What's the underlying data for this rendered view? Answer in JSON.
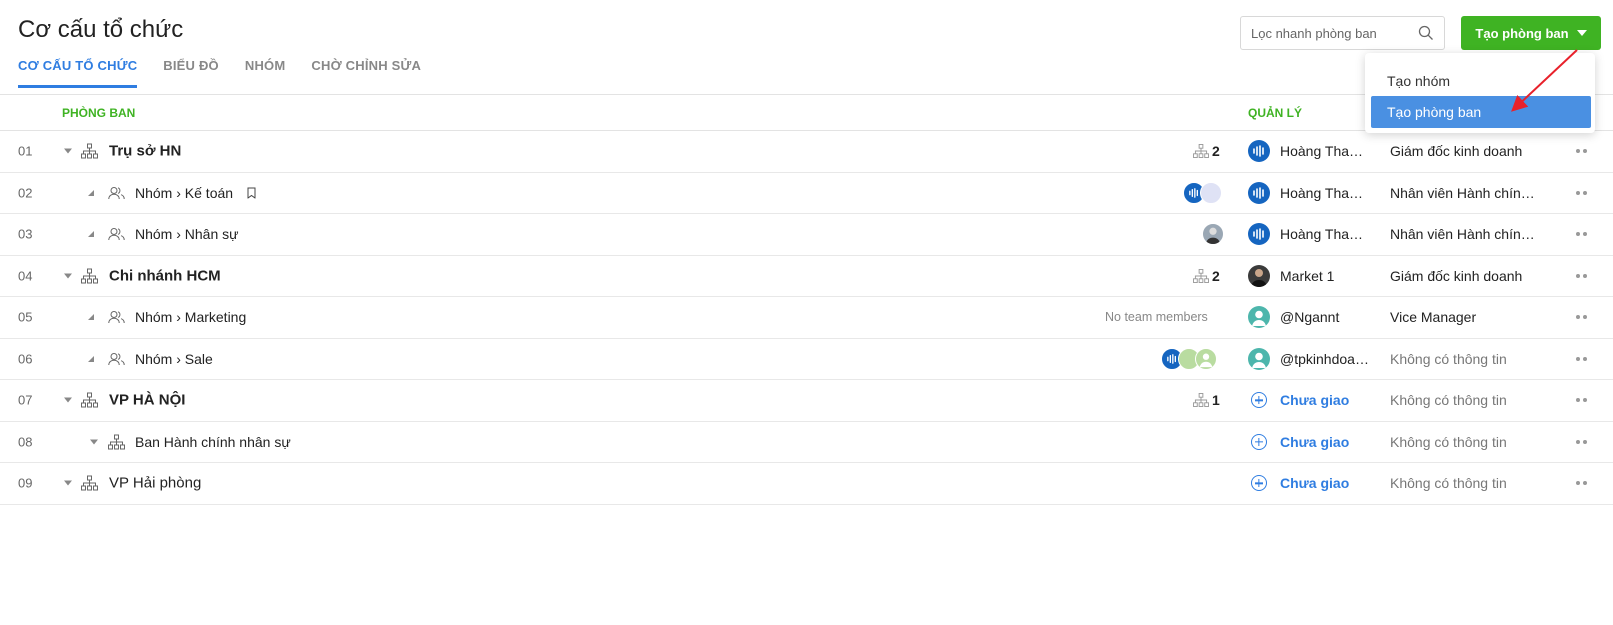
{
  "header": {
    "title": "Cơ cấu tổ chức",
    "search_placeholder": "Lọc nhanh phòng ban",
    "create_button_label": "Tạo phòng ban"
  },
  "tabs": [
    {
      "label": "CƠ CẤU TỔ CHỨC",
      "active": true
    },
    {
      "label": "BIỂU ĐỒ",
      "active": false
    },
    {
      "label": "NHÓM",
      "active": false
    },
    {
      "label": "CHỜ CHỈNH SỬA",
      "active": false
    }
  ],
  "columns": {
    "department": "PHÒNG BAN",
    "manager": "QUẢN LÝ"
  },
  "dropdown": {
    "items": [
      {
        "label": "Tạo nhóm",
        "selected": false
      },
      {
        "label": "Tạo phòng ban",
        "selected": true
      }
    ]
  },
  "rows": [
    {
      "num": "01",
      "name": "Trụ sở HN",
      "sub_count": "2",
      "manager": "Hoàng Thanh Tùng",
      "role": "Giám đốc kinh doanh"
    },
    {
      "num": "02",
      "name": "Nhóm › Kế toán",
      "manager": "Hoàng Thanh Tùng",
      "role": "Nhân viên Hành chính nhân sự"
    },
    {
      "num": "03",
      "name": "Nhóm › Nhân sự",
      "manager": "Hoàng Thanh Tùng",
      "role": "Nhân viên Hành chính nhân sự"
    },
    {
      "num": "04",
      "name": "Chi nhánh HCM",
      "sub_count": "2",
      "manager": "Market 1",
      "role": "Giám đốc kinh doanh"
    },
    {
      "num": "05",
      "name": "Nhóm › Marketing",
      "members_note": "No team members",
      "manager": "@Ngannt",
      "role": "Vice Manager"
    },
    {
      "num": "06",
      "name": "Nhóm › Sale",
      "manager": "@tpkinhdoanh",
      "role": "Không có thông tin"
    },
    {
      "num": "07",
      "name": "VP HÀ NỘI",
      "sub_count": "1",
      "manager": "Chưa giao",
      "role": "Không có thông tin"
    },
    {
      "num": "08",
      "name": "Ban Hành chính nhân sự",
      "manager": "Chưa giao",
      "role": "Không có thông tin"
    },
    {
      "num": "09",
      "name": "VP Hải phòng",
      "manager": "Chưa giao",
      "role": "Không có thông tin"
    }
  ],
  "colors": {
    "accent_blue": "#2f7de1",
    "accent_green": "#3fb323",
    "dropdown_selected": "#4a90e2",
    "annotation_arrow": "#e8212b"
  }
}
